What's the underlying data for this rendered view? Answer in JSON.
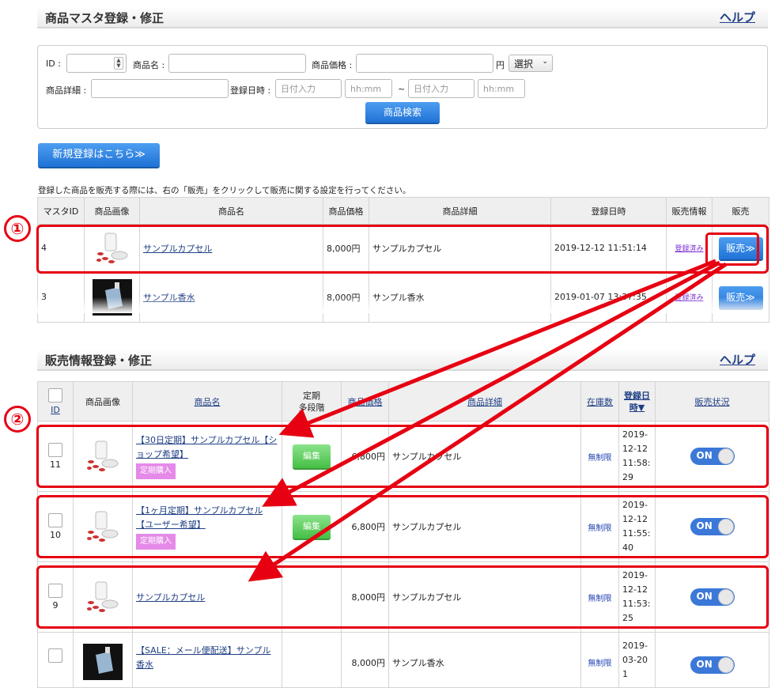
{
  "master_section": {
    "title": "商品マスタ登録・修正",
    "help": "ヘルプ"
  },
  "search": {
    "id_label": "ID :",
    "name_label": "商品名 :",
    "price_label": "商品価格 :",
    "yen": "円",
    "select_label": "選択",
    "detail_label": "商品詳細 :",
    "date_label": "登録日時 :",
    "date_placeholder": "日付入力",
    "time_placeholder": "hh:mm",
    "tilde": "~",
    "search_button": "商品検索"
  },
  "new_register_button": "新規登録はこちら≫",
  "notice": "登録した商品を販売する際には、右の「販売」をクリックして販売に関する設定を行ってください。",
  "master_table": {
    "headers": [
      "マスタID",
      "商品画像",
      "商品名",
      "商品価格",
      "商品詳細",
      "登録日時",
      "販売情報",
      "販売"
    ],
    "rows": [
      {
        "id": "4",
        "name": "サンプルカプセル",
        "price": "8,000円",
        "detail": "サンプルカプセル",
        "date": "2019-12-12 11:51:14",
        "status": "登録済み",
        "sell": "販売≫"
      },
      {
        "id": "3",
        "name": "サンプル香水",
        "price": "8,000円",
        "detail": "サンプル香水",
        "date": "2019-01-07 13:37:35",
        "status": "登録済み",
        "sell": "販売≫"
      }
    ]
  },
  "sales_section": {
    "title": "販売情報登録・修正",
    "help": "ヘルプ"
  },
  "sales_table": {
    "headers": {
      "id": "ID",
      "image": "商品画像",
      "name": "商品名",
      "multi_stage_1": "定期",
      "multi_stage_2": "多段階",
      "price": "商品価格",
      "detail": "商品詳細",
      "stock": "在庫数",
      "date_1": "登録日",
      "date_2": "時▼",
      "status": "販売状況"
    },
    "rows": [
      {
        "id": "11",
        "name": "【30日定期】サンプルカプセル【ショップ希望】",
        "tag": "定期購入",
        "edit": "編集",
        "price": "6,800円",
        "detail": "サンプルカプセル",
        "stock": "無制限",
        "date": "2019-12-12 11:58:29",
        "toggle": "ON"
      },
      {
        "id": "10",
        "name": "【1ヶ月定期】サンプルカプセル【ユーザー希望】",
        "tag": "定期購入",
        "edit": "編集",
        "price": "6,800円",
        "detail": "サンプルカプセル",
        "stock": "無制限",
        "date": "2019-12-12 11:55:40",
        "toggle": "ON"
      },
      {
        "id": "9",
        "name": "サンプルカプセル",
        "tag": "",
        "edit": "",
        "price": "8,000円",
        "detail": "サンプルカプセル",
        "stock": "無制限",
        "date": "2019-12-12 11:53:25",
        "toggle": "ON"
      },
      {
        "id": "",
        "name": "【SALE：メール便配送】サンプル香水",
        "tag": "",
        "edit": "",
        "price": "8,000円",
        "detail": "サンプル香水",
        "stock": "無制限",
        "date": "2019-03-20 1",
        "toggle": "ON"
      }
    ]
  },
  "annotations": {
    "marker_1": "①",
    "marker_2": "②",
    "color": "#e60012"
  }
}
